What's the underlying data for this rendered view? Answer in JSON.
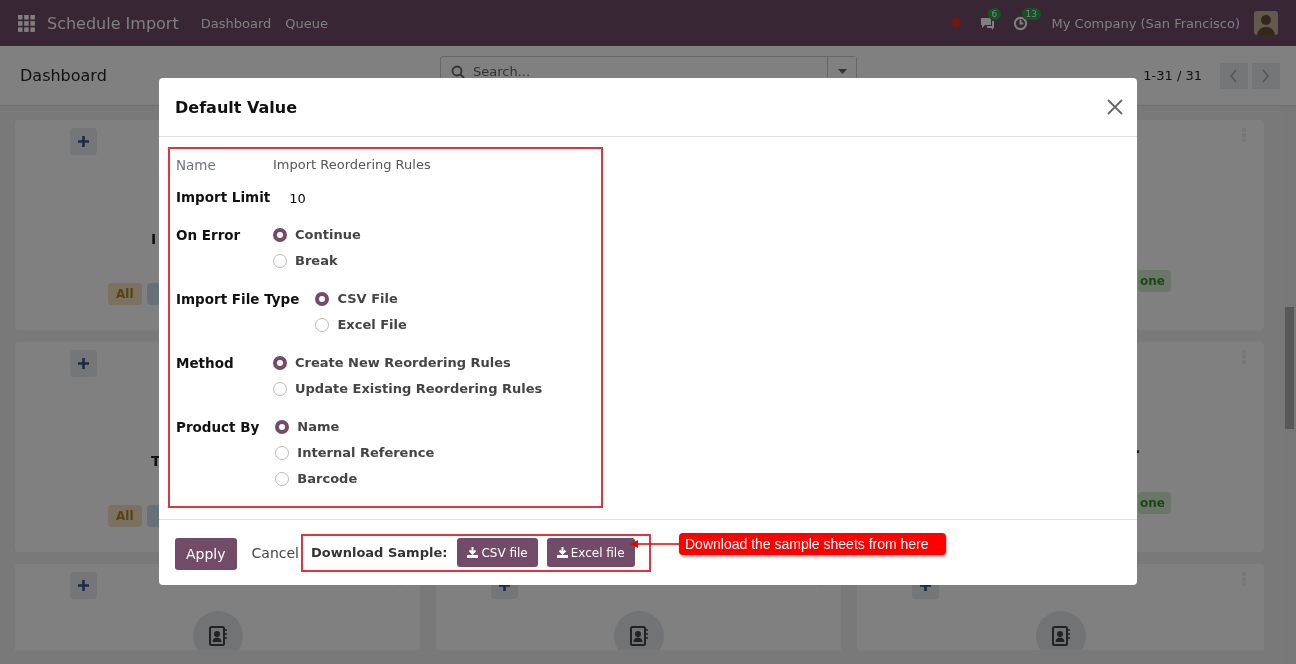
{
  "navbar": {
    "app_name": "Schedule Import",
    "menu": [
      {
        "label": "Dashboard"
      },
      {
        "label": "Queue"
      }
    ],
    "messages_count": "6",
    "activities_count": "13",
    "company": "My Company (San Francisco)"
  },
  "control_panel": {
    "title": "Dashboard",
    "search": {
      "placeholder": "Search..."
    },
    "pager": "1-31 / 31"
  },
  "cards": [
    {
      "kind": "stat",
      "title": "I",
      "badge": "All",
      "color": "#7a7160"
    },
    {
      "kind": "stat",
      "badge": "one",
      "color": "#6a7668"
    },
    {
      "kind": "stat",
      "title": "T",
      "badge": "All",
      "color": "#7a7160"
    },
    {
      "kind": "stat",
      "title": ".",
      "badge": "one",
      "color": "#6a7668"
    },
    {
      "kind": "tile"
    },
    {
      "kind": "tile"
    },
    {
      "kind": "tile"
    }
  ],
  "dialog": {
    "title": "Default Value",
    "fields": [
      {
        "kind": "readonly",
        "label": "Name",
        "value": "Import Reordering Rules"
      },
      {
        "kind": "input",
        "label": "Import Limit",
        "value": "10"
      },
      {
        "kind": "radio",
        "label": "On Error",
        "options": [
          {
            "label": "Continue",
            "selected": true
          },
          {
            "label": "Break",
            "selected": false
          }
        ]
      },
      {
        "kind": "radio",
        "label": "Import File Type",
        "options": [
          {
            "label": "CSV File",
            "selected": true
          },
          {
            "label": "Excel File",
            "selected": false
          }
        ]
      },
      {
        "kind": "radio",
        "label": "Method",
        "options": [
          {
            "label": "Create New Reordering Rules",
            "selected": true
          },
          {
            "label": "Update Existing Reordering Rules",
            "selected": false
          }
        ]
      },
      {
        "kind": "radio",
        "label": "Product By",
        "options": [
          {
            "label": "Name",
            "selected": true
          },
          {
            "label": "Internal Reference",
            "selected": false
          },
          {
            "label": "Barcode",
            "selected": false
          }
        ]
      }
    ],
    "apply": "Apply",
    "cancel": "Cancel",
    "download": {
      "label": "Download Sample:",
      "buttons": [
        {
          "label": "CSV file"
        },
        {
          "label": "Excel file"
        }
      ]
    }
  },
  "annotation": {
    "text": "Download the sample sheets from here"
  }
}
